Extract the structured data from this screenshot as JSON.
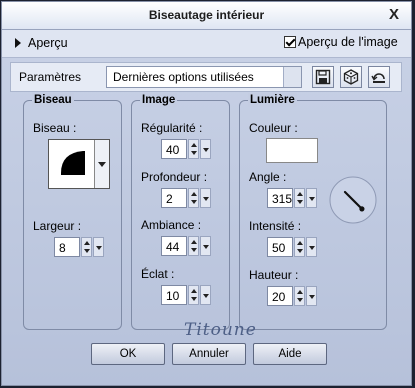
{
  "window": {
    "title": "Biseautage intérieur",
    "close_label": "X"
  },
  "preview": {
    "label": "Aperçu",
    "image_preview_label": "Aperçu de l'image",
    "image_preview_checked": true
  },
  "params": {
    "label": "Paramètres",
    "preset_value": "Dernières options utilisées"
  },
  "biseau": {
    "title": "Biseau",
    "shape_label": "Biseau :",
    "width_label": "Largeur :",
    "width_value": "8"
  },
  "image": {
    "title": "Image",
    "smoothness_label": "Régularité :",
    "smoothness_value": "40",
    "depth_label": "Profondeur :",
    "depth_value": "2",
    "ambience_label": "Ambiance :",
    "ambience_value": "44",
    "shininess_label": "Éclat :",
    "shininess_value": "10"
  },
  "light": {
    "title": "Lumière",
    "color_label": "Couleur :",
    "color_value": "#ffffff",
    "angle_label": "Angle :",
    "angle_value": "315",
    "intensity_label": "Intensité :",
    "intensity_value": "50",
    "elevation_label": "Hauteur :",
    "elevation_value": "20"
  },
  "watermark": "Titoune",
  "buttons": {
    "ok": "OK",
    "cancel": "Annuler",
    "help": "Aide"
  }
}
